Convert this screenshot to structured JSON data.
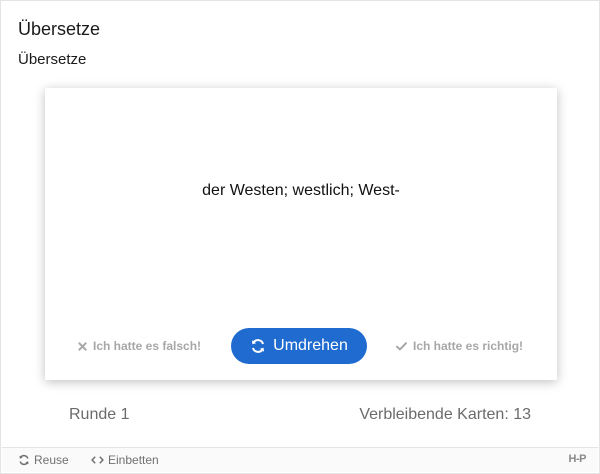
{
  "header": {
    "title": "Übersetze",
    "subtitle": "Übersetze"
  },
  "card": {
    "text": "der Westen; westlich; West-",
    "wrong_label": "Ich hatte es falsch!",
    "flip_label": "Umdrehen",
    "right_label": "Ich hatte es richtig!"
  },
  "status": {
    "round_text": "Runde 1",
    "remaining_text": "Verbleibende Karten: 13"
  },
  "footer": {
    "reuse_label": "Reuse",
    "embed_label": "Einbetten",
    "logo_text": "H-P"
  },
  "colors": {
    "accent": "#1f6bd0",
    "muted": "#a7a7a7"
  },
  "icons": {
    "wrong": "close-icon",
    "flip": "refresh-icon",
    "right": "check-icon",
    "reuse": "recycle-icon",
    "embed": "code-icon"
  }
}
